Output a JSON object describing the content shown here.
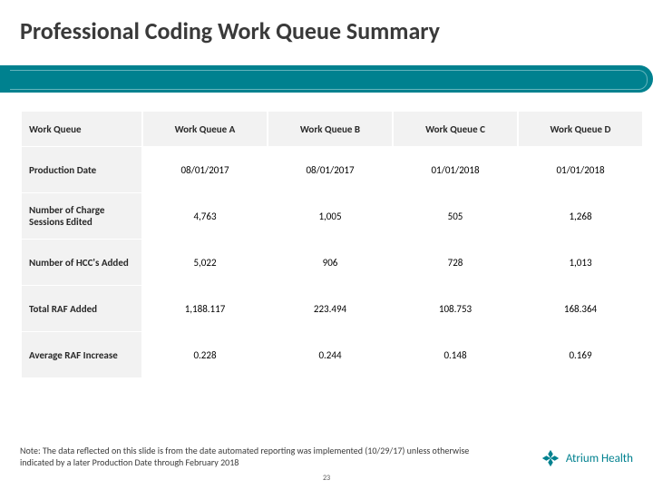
{
  "title": "Professional Coding Work Queue Summary",
  "table": {
    "header_label": "Work Queue",
    "columns": [
      "Work Queue A",
      "Work Queue B",
      "Work Queue C",
      "Work Queue D"
    ],
    "rows": [
      {
        "label": "Production Date",
        "cells": [
          "08/01/2017",
          "08/01/2017",
          "01/01/2018",
          "01/01/2018"
        ]
      },
      {
        "label": "Number of Charge Sessions Edited",
        "cells": [
          "4,763",
          "1,005",
          "505",
          "1,268"
        ]
      },
      {
        "label": "Number of HCC's Added",
        "cells": [
          "5,022",
          "906",
          "728",
          "1,013"
        ]
      },
      {
        "label": "Total RAF Added",
        "cells": [
          "1,188.117",
          "223.494",
          "108.753",
          "168.364"
        ]
      },
      {
        "label": "Average RAF Increase",
        "cells": [
          "0.228",
          "0.244",
          "0.148",
          "0.169"
        ]
      }
    ]
  },
  "note": "Note: The data reflected on this slide is from the date automated reporting was implemented (10/29/17) unless otherwise indicated by a later Production Date through February 2018",
  "page_number": "23",
  "brand": {
    "name": "Atrium Health",
    "color": "#00818f"
  },
  "chart_data": {
    "type": "table",
    "title": "Professional Coding Work Queue Summary",
    "columns": [
      "Work Queue",
      "Work Queue A",
      "Work Queue B",
      "Work Queue C",
      "Work Queue D"
    ],
    "rows": [
      [
        "Production Date",
        "08/01/2017",
        "08/01/2017",
        "01/01/2018",
        "01/01/2018"
      ],
      [
        "Number of Charge Sessions Edited",
        4763,
        1005,
        505,
        1268
      ],
      [
        "Number of HCC's Added",
        5022,
        906,
        728,
        1013
      ],
      [
        "Total RAF Added",
        1188.117,
        223.494,
        108.753,
        168.364
      ],
      [
        "Average RAF Increase",
        0.228,
        0.244,
        0.148,
        0.169
      ]
    ]
  }
}
